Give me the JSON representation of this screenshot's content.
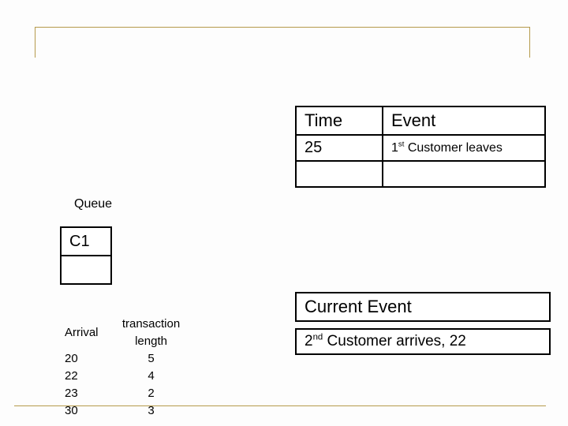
{
  "timeEvent": {
    "headTime": "Time",
    "headEvent": "Event",
    "row1Time": "25",
    "row1EventPre": "1",
    "row1EventSup": "st",
    "row1EventPost": " Customer leaves",
    "row2Time": "",
    "row2Event": ""
  },
  "queue": {
    "label": "Queue",
    "cell0": "C1",
    "cell1": ""
  },
  "current": {
    "header": "Current Event",
    "bodyPre": "2",
    "bodySup": "nd",
    "bodyPost": " Customer arrives, 22"
  },
  "arrivals": {
    "hArrival": "Arrival",
    "hTrans": "transaction length",
    "r0a": "20",
    "r0t": "5",
    "r1a": "22",
    "r1t": "4",
    "r2a": "23",
    "r2t": "2",
    "r3a": "30",
    "r3t": "3"
  }
}
